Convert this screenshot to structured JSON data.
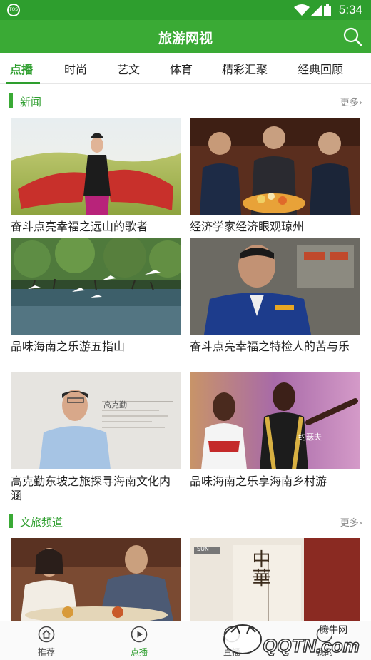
{
  "status": {
    "time": "5:34"
  },
  "header": {
    "title": "旅游网视"
  },
  "tabs": [
    {
      "label": "点播",
      "active": true
    },
    {
      "label": "时尚"
    },
    {
      "label": "艺文"
    },
    {
      "label": "体育"
    },
    {
      "label": "精彩汇聚"
    },
    {
      "label": "经典回顾"
    }
  ],
  "sections": [
    {
      "name": "新闻",
      "more": "更多",
      "items": [
        {
          "caption": "奋斗点亮幸福之远山的歌者"
        },
        {
          "caption": "经济学家经济眼观琼州"
        },
        {
          "caption": "品味海南之乐游五指山"
        },
        {
          "caption": "奋斗点亮幸福之特检人的苦与乐"
        },
        {
          "caption": "高克勤东坡之旅探寻海南文化内涵"
        },
        {
          "caption": "品味海南之乐享海南乡村游"
        }
      ]
    },
    {
      "name": "文旅频道",
      "more": "更多",
      "items": [
        {
          "caption": ""
        },
        {
          "caption": ""
        }
      ]
    }
  ],
  "thumb_text": {
    "name_card": "高克勤",
    "person_label": "约瑟夫",
    "book_chars": "中華",
    "book_brand": "SUN"
  },
  "bottom_nav": [
    {
      "label": "推荐",
      "icon": "home-icon"
    },
    {
      "label": "点播",
      "icon": "play-icon",
      "active": true
    },
    {
      "label": "直播",
      "icon": "tv-icon"
    },
    {
      "label": "我的",
      "icon": "user-icon"
    }
  ],
  "watermark": {
    "text": "腾牛网",
    "brand": "QQTN.com"
  },
  "colors": {
    "primary": "#3aaa35",
    "primary_dark": "#2e9e2e",
    "more": "#888888"
  }
}
